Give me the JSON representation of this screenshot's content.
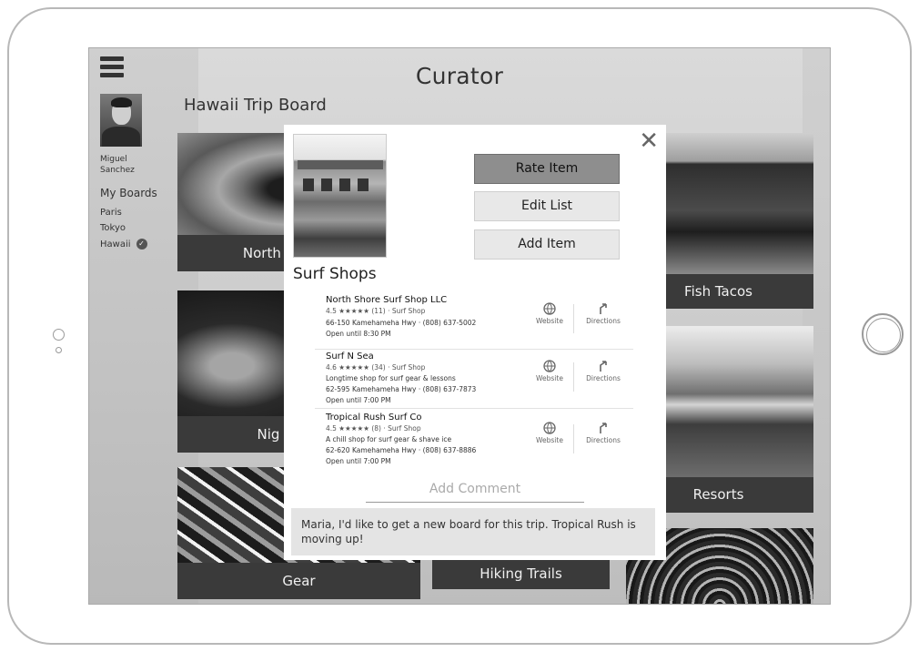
{
  "app": {
    "title": "Curator"
  },
  "board": {
    "title": "Hawaii Trip Board"
  },
  "user": {
    "name": "Miguel Sanchez"
  },
  "sidebar": {
    "heading": "My Boards",
    "items": [
      {
        "label": "Paris"
      },
      {
        "label": "Tokyo"
      },
      {
        "label": "Hawaii",
        "selected": true
      }
    ]
  },
  "cards": [
    {
      "label": "North S"
    },
    {
      "label": "Nig"
    },
    {
      "label": "Gear"
    },
    {
      "label": "Hiking Trails"
    },
    {
      "label": "Fish Tacos"
    },
    {
      "label": "Resorts"
    }
  ],
  "modal": {
    "close_label": "✕",
    "title": "Surf Shops",
    "buttons": {
      "rate": "Rate Item",
      "edit": "Edit List",
      "add": "Add Item"
    },
    "listings": [
      {
        "name": "North Shore Surf Shop LLC",
        "meta": "4.5 ★★★★★ (11) · Surf Shop",
        "lines": [
          "66-150 Kamehameha Hwy · (808) 637-5002",
          "Open until 8:30 PM"
        ]
      },
      {
        "name": "Surf N Sea",
        "meta": "4.6 ★★★★★ (34) · Surf Shop",
        "lines": [
          "Longtime shop for surf gear & lessons",
          "62-595 Kamehameha Hwy · (808) 637-7873",
          "Open until 7:00 PM"
        ]
      },
      {
        "name": "Tropical Rush Surf Co",
        "meta": "4.5 ★★★★★ (8) · Surf Shop",
        "lines": [
          "A chill shop for surf gear & shave ice",
          "62-620 Kamehameha Hwy · (808) 637-8886",
          "Open until 7:00 PM"
        ]
      }
    ],
    "actions": {
      "website": "Website",
      "directions": "Directions"
    },
    "comment_placeholder": "Add Comment",
    "comment_text": "Maria, I'd like to get a new board for this trip. Tropical Rush is moving up!"
  },
  "colors": {
    "screen_bg": "#d4d4d4",
    "label_bar": "#3a3a3a",
    "primary_button": "#8e8e8e"
  }
}
